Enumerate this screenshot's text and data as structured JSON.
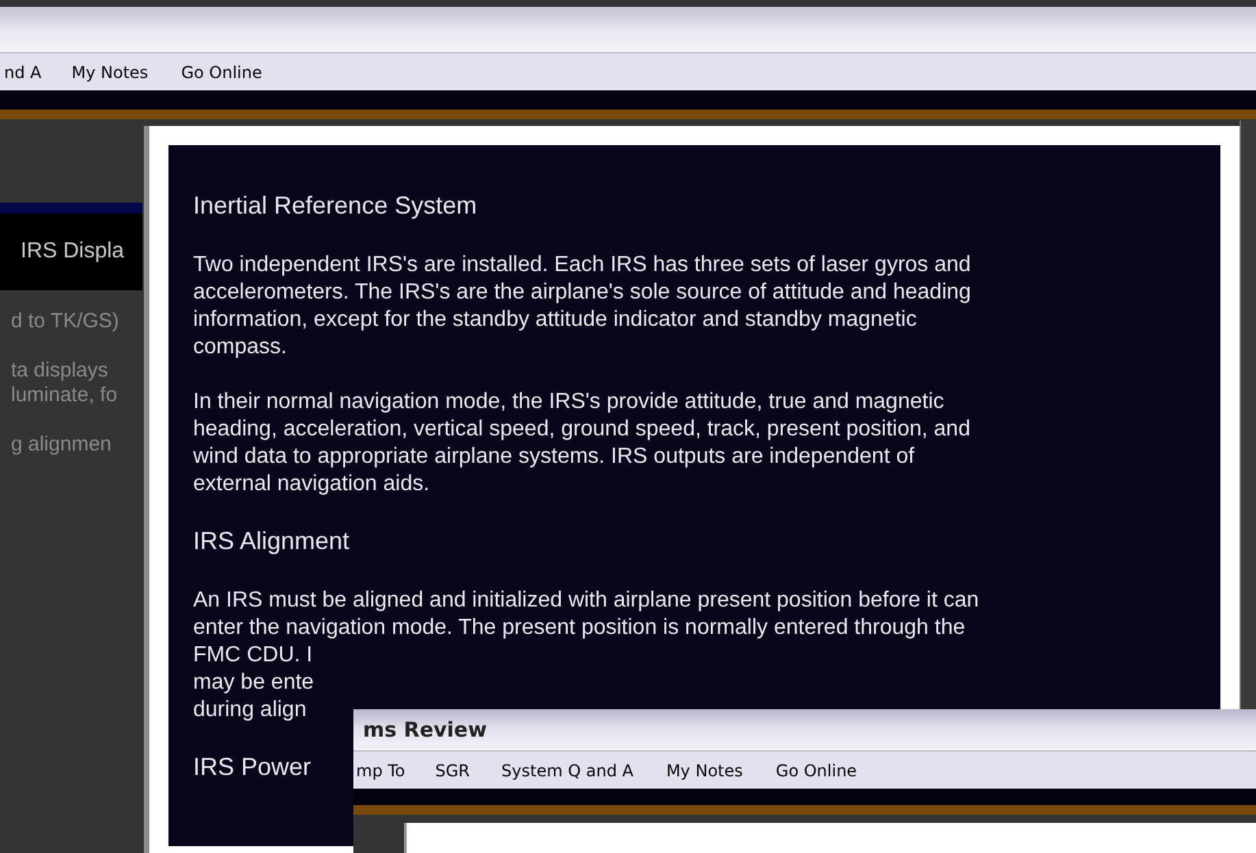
{
  "background_window": {
    "menu": [
      "nd A",
      "My Notes",
      "Go Online"
    ],
    "sidebar": {
      "header": "IRS Displa",
      "items": [
        [
          "d to TK/GS)"
        ],
        [
          "ta displays",
          "luminate, fo"
        ],
        [
          "g alignmen"
        ]
      ]
    }
  },
  "article": {
    "blocks": [
      {
        "kind": "heading",
        "text": "Inertial Reference System"
      },
      {
        "kind": "paragraph",
        "lines": [
          "Two independent IRS's are installed. Each IRS has three sets of laser gyros and",
          "accelerometers. The IRS's are the airplane's sole source of attitude and heading",
          "information, except for the standby attitude indicator and standby magnetic",
          "compass."
        ]
      },
      {
        "kind": "paragraph",
        "lines": [
          "In their normal navigation mode, the IRS's provide attitude, true and magnetic",
          "heading, acceleration, vertical speed, ground speed, track, present position, and",
          "wind data to appropriate airplane systems. IRS outputs are independent of",
          "external navigation aids."
        ]
      },
      {
        "kind": "heading",
        "text": "IRS Alignment"
      },
      {
        "kind": "paragraph",
        "lines": [
          "An IRS must be aligned and initialized with airplane present position before it can",
          "enter the navigation mode. The present position is normally entered through the",
          "FMC CDU. I",
          "may be ente",
          "during align"
        ]
      },
      {
        "kind": "heading",
        "text": "IRS Power"
      }
    ]
  },
  "front_window": {
    "title": "ms Review",
    "menu": [
      "mp To",
      "SGR",
      "System Q and A",
      "My Notes",
      "Go Online"
    ]
  }
}
